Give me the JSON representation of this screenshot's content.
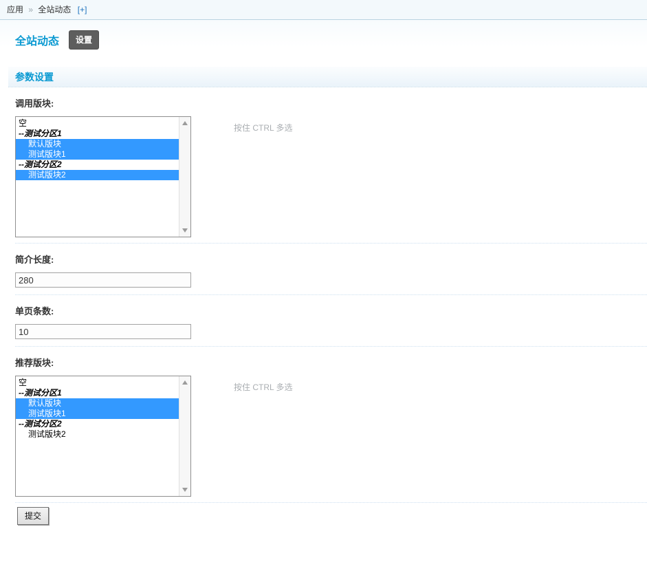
{
  "breadcrumb": {
    "app": "应用",
    "separator": "»",
    "current": "全站动态",
    "add_link": "[+]"
  },
  "header": {
    "title": "全站动态",
    "settings_button": "设置"
  },
  "section": {
    "title": "参数设置"
  },
  "form": {
    "hint_multiselect": "按住 CTRL 多选",
    "fields": {
      "call_forums": {
        "label": "调用版块:",
        "options": [
          {
            "text": "空",
            "type": "option",
            "indent": 0,
            "selected": false
          },
          {
            "text": "--测试分区1",
            "type": "group",
            "indent": 0,
            "selected": false
          },
          {
            "text": "默认版块",
            "type": "option",
            "indent": 1,
            "selected": true
          },
          {
            "text": "测试版块1",
            "type": "option",
            "indent": 1,
            "selected": true
          },
          {
            "text": "--测试分区2",
            "type": "group",
            "indent": 0,
            "selected": false
          },
          {
            "text": "测试版块2",
            "type": "option",
            "indent": 1,
            "selected": true
          }
        ]
      },
      "summary_length": {
        "label": "简介长度:",
        "value": "280"
      },
      "per_page": {
        "label": "单页条数:",
        "value": "10"
      },
      "recommend_forums": {
        "label": "推荐版块:",
        "options": [
          {
            "text": "空",
            "type": "option",
            "indent": 0,
            "selected": false
          },
          {
            "text": "--测试分区1",
            "type": "group",
            "indent": 0,
            "selected": false
          },
          {
            "text": "默认版块",
            "type": "option",
            "indent": 1,
            "selected": true
          },
          {
            "text": "测试版块1",
            "type": "option",
            "indent": 1,
            "selected": true
          },
          {
            "text": "--测试分区2",
            "type": "group",
            "indent": 0,
            "selected": false
          },
          {
            "text": "测试版块2",
            "type": "option",
            "indent": 1,
            "selected": false
          }
        ]
      }
    },
    "submit_label": "提交"
  },
  "colors": {
    "accent": "#0b9ad2",
    "selection": "#3399ff",
    "link-blue": "#1e73be",
    "btn-dark": "#5e5e5e",
    "topbar-bg": "#f3f9fc",
    "topbar-border": "#b9d4e1",
    "row-sep": "#cbdff0"
  }
}
